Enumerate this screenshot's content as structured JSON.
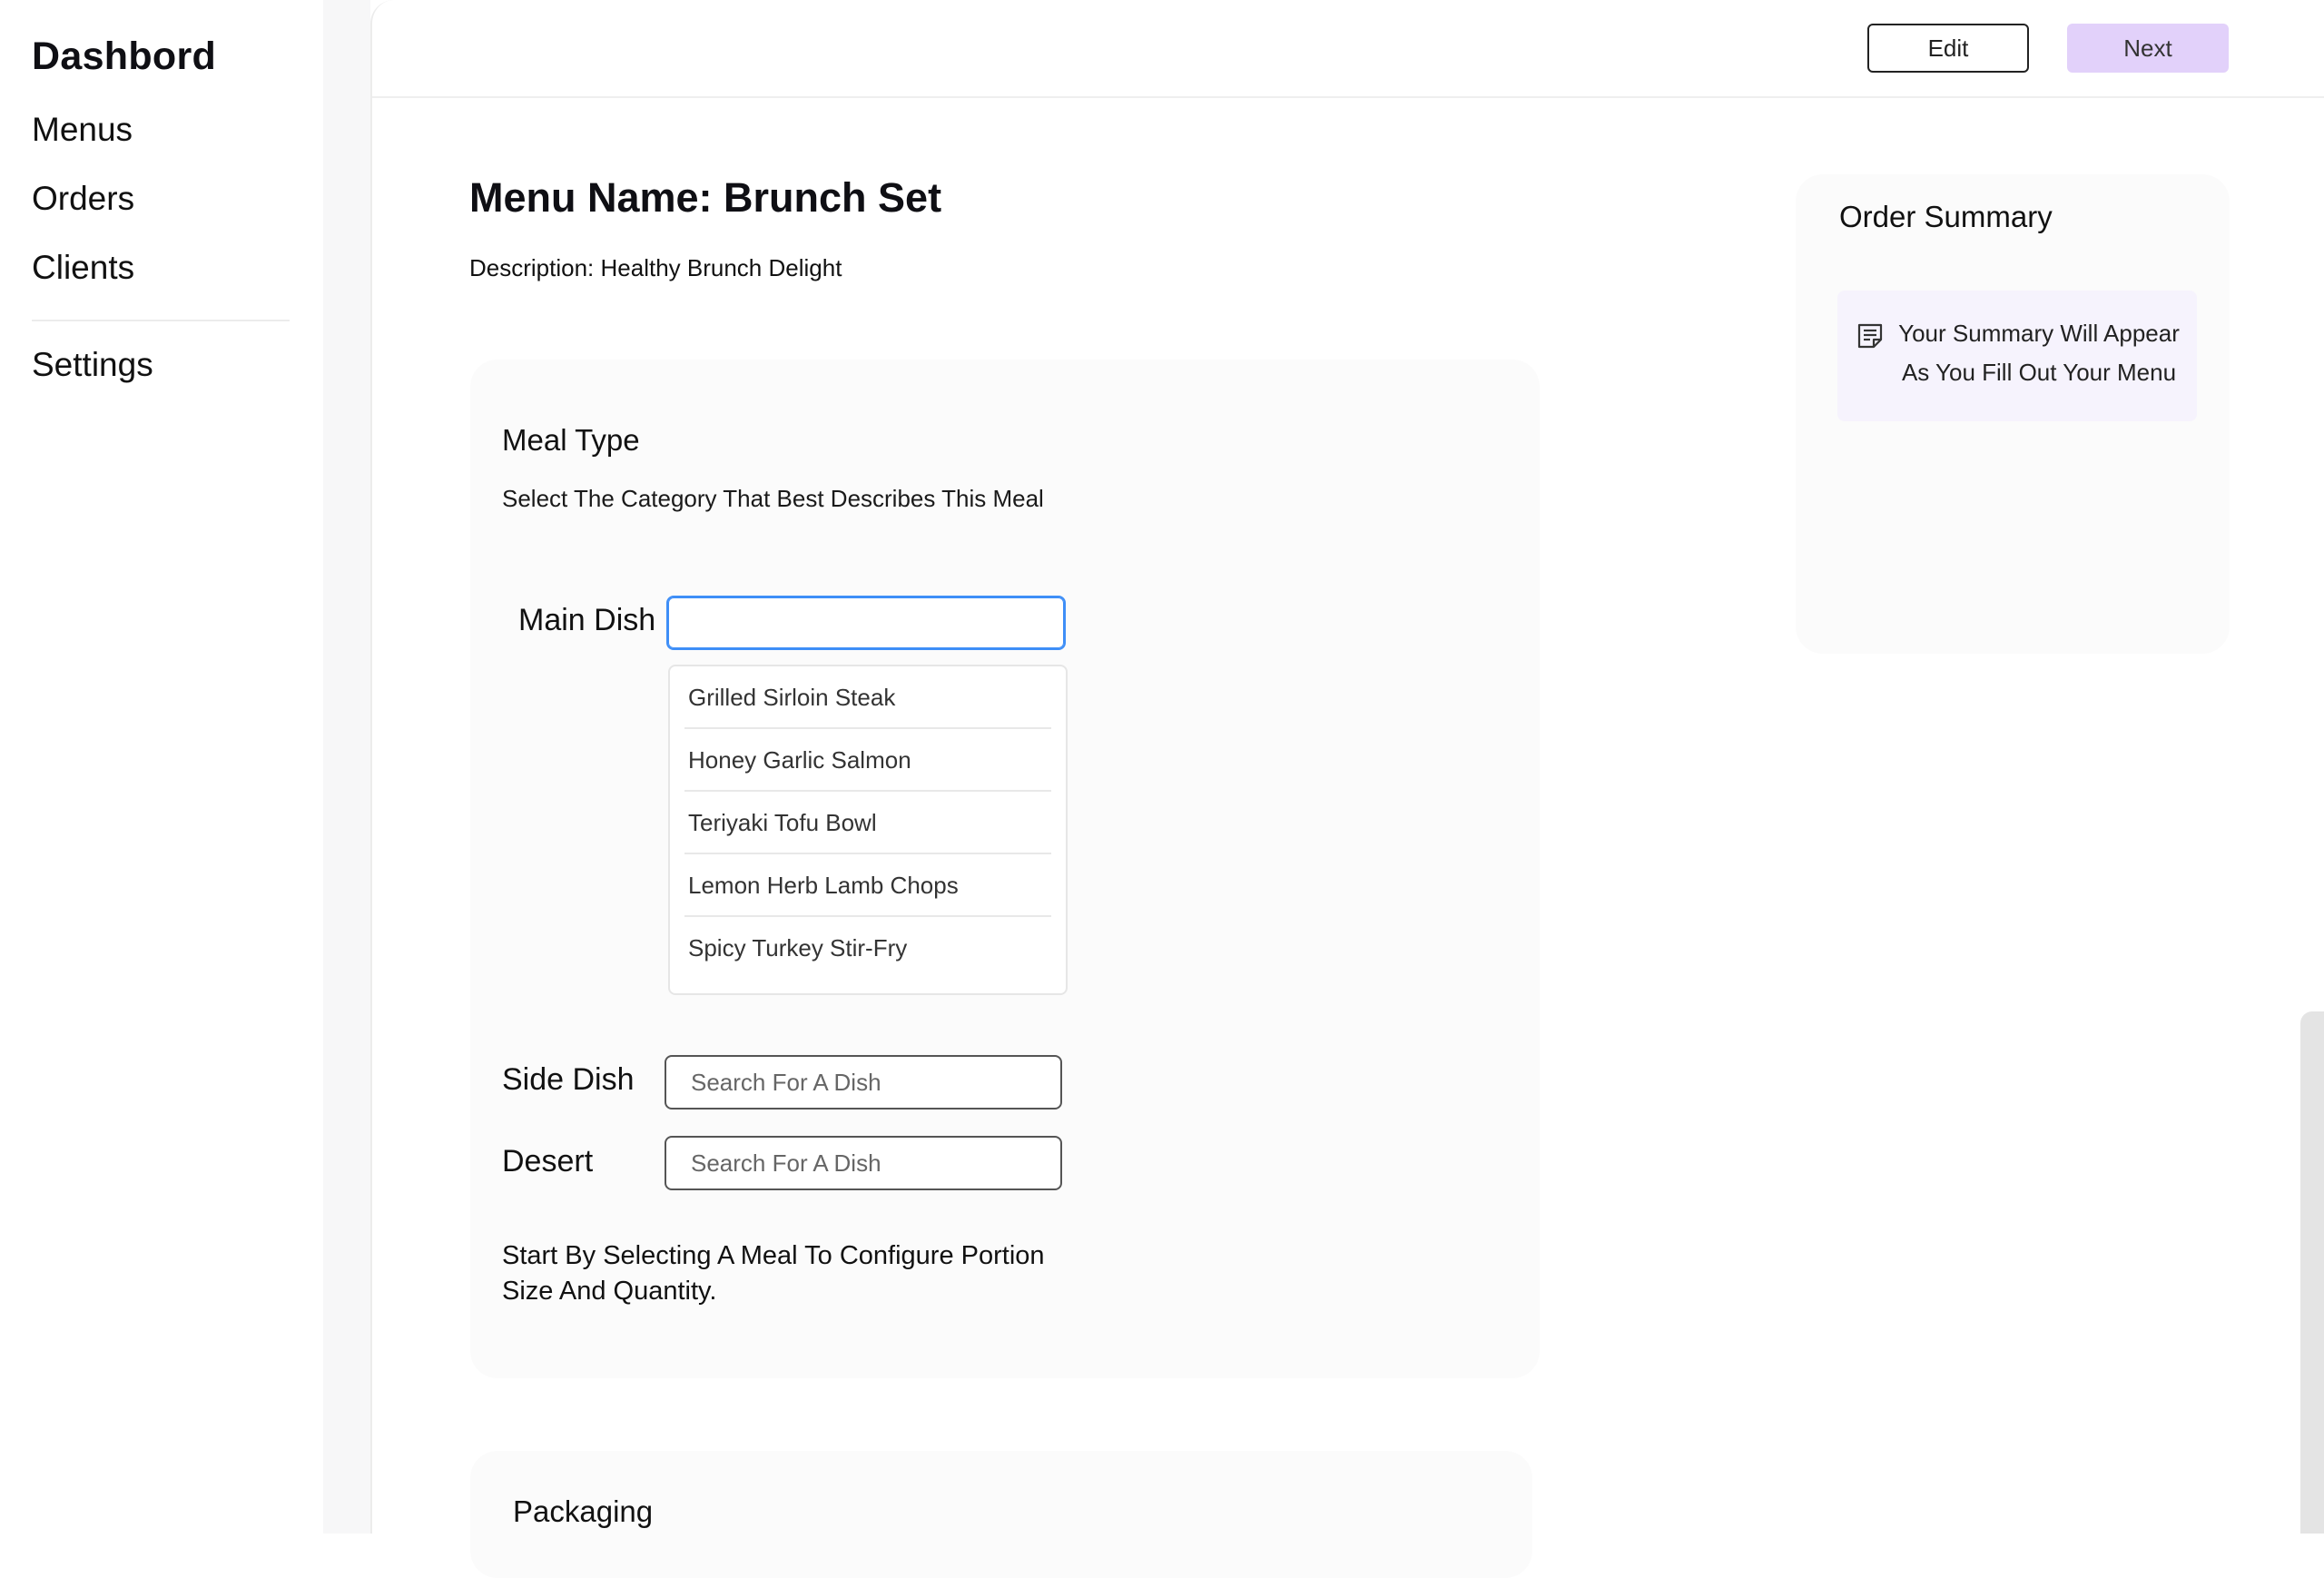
{
  "sidebar": {
    "title": "Dashbord",
    "items": [
      {
        "label": "Menus"
      },
      {
        "label": "Orders"
      },
      {
        "label": "Clients"
      },
      {
        "label": "Settings"
      }
    ]
  },
  "topbar": {
    "edit_label": "Edit",
    "next_label": "Next"
  },
  "menu": {
    "title": "Menu Name: Brunch Set",
    "description": "Description: Healthy Brunch Delight"
  },
  "meal_type": {
    "title": "Meal Type",
    "subtitle": "Select The Category That Best Describes This Meal",
    "main_dish_label": "Main Dish",
    "main_dish_value": "",
    "options": [
      "Grilled Sirloin Steak",
      "Honey Garlic Salmon",
      "Teriyaki Tofu Bowl",
      "Lemon Herb Lamb Chops",
      "Spicy Turkey Stir-Fry"
    ],
    "side_dish_label": "Side Dish",
    "side_dish_placeholder": "Search For A Dish",
    "desert_label": "Desert",
    "desert_placeholder": "Search For A Dish",
    "hint": "Start By Selecting A Meal To Configure Portion Size And Quantity."
  },
  "packaging": {
    "title": "Packaging"
  },
  "summary": {
    "title": "Order Summary",
    "empty_text": "Your Summary Will Appear As You Fill Out Your Menu",
    "icon": "note-icon"
  },
  "colors": {
    "accent": "#e2d1fa",
    "focus": "#3e8ef7",
    "summary_bg": "#f6f3fd"
  }
}
